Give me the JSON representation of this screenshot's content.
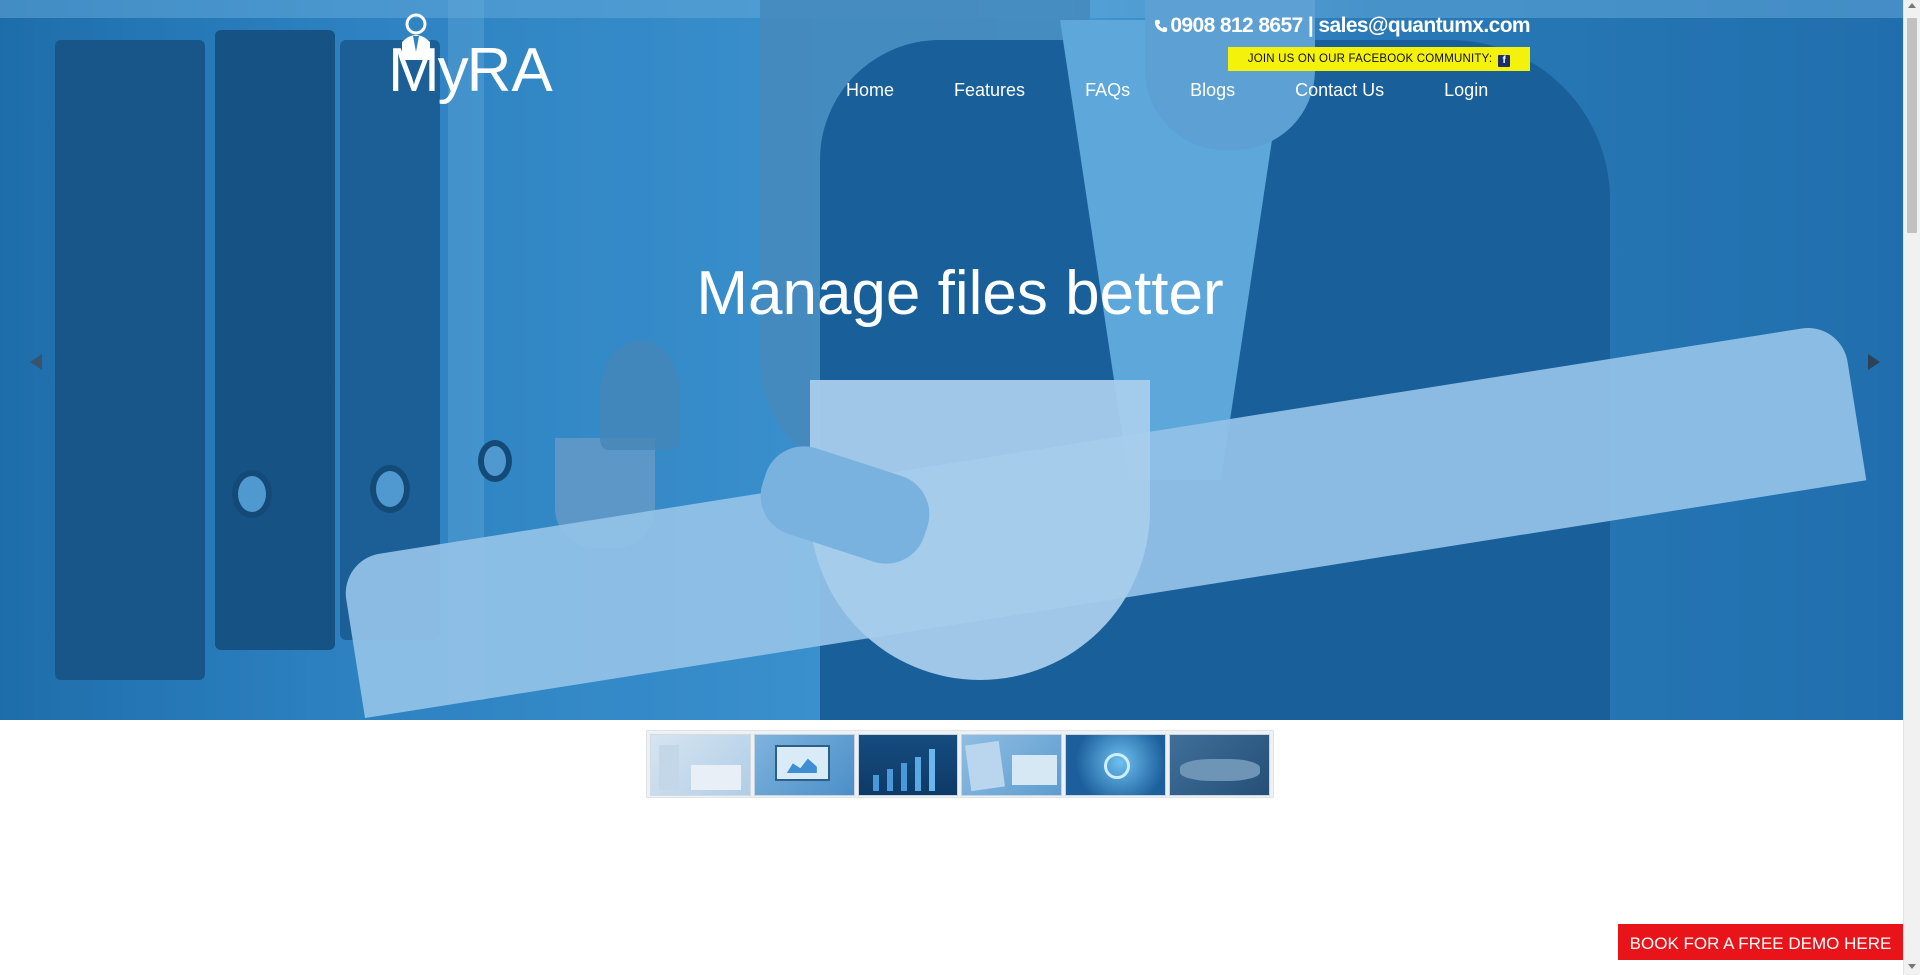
{
  "logo": {
    "text_my": "My",
    "text_ra": "RA"
  },
  "contact": {
    "phone": "0908 812 8657",
    "separator": " | ",
    "email": "sales@quantumx.com"
  },
  "facebook_banner": {
    "text": "JOIN US ON OUR FACEBOOK COMMUNITY:",
    "icon": "f"
  },
  "nav": {
    "items": [
      {
        "label": "Home"
      },
      {
        "label": "Features"
      },
      {
        "label": "FAQs"
      },
      {
        "label": "Blogs"
      },
      {
        "label": "Contact Us"
      },
      {
        "label": "Login"
      }
    ]
  },
  "hero": {
    "headline": "Manage files better",
    "prev_icon": "triangle-left-icon",
    "next_icon": "triangle-right-icon"
  },
  "thumbnails": {
    "count": 6,
    "active_index": 0
  },
  "demo_button": {
    "label": "BOOK FOR A FREE DEMO HERE"
  },
  "colors": {
    "brand_blue": "#2f82bf",
    "facebook_banner": "#f4f20a",
    "demo_button": "#e8141a"
  }
}
